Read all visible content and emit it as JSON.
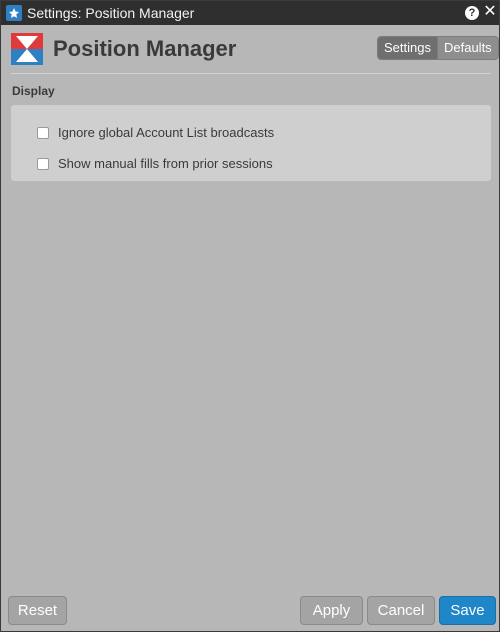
{
  "window": {
    "title": "Settings: Position Manager",
    "help_icon": "help-icon",
    "close_icon": "close-icon"
  },
  "header": {
    "heading": "Position Manager",
    "logo_icon": "position-manager-logo",
    "tabs": [
      {
        "label": "Settings",
        "active": true
      },
      {
        "label": "Defaults",
        "active": false
      }
    ]
  },
  "display": {
    "section_title": "Display",
    "options": [
      {
        "label": "Ignore global Account List broadcasts",
        "checked": false
      },
      {
        "label": "Show manual fills from prior sessions",
        "checked": false
      }
    ]
  },
  "footer": {
    "reset_label": "Reset",
    "apply_label": "Apply",
    "cancel_label": "Cancel",
    "save_label": "Save"
  },
  "colors": {
    "accent": "#1f86c8",
    "titlebar": "#2f2f2f",
    "logo_red": "#e13a3a",
    "logo_blue": "#2e7fc4"
  }
}
